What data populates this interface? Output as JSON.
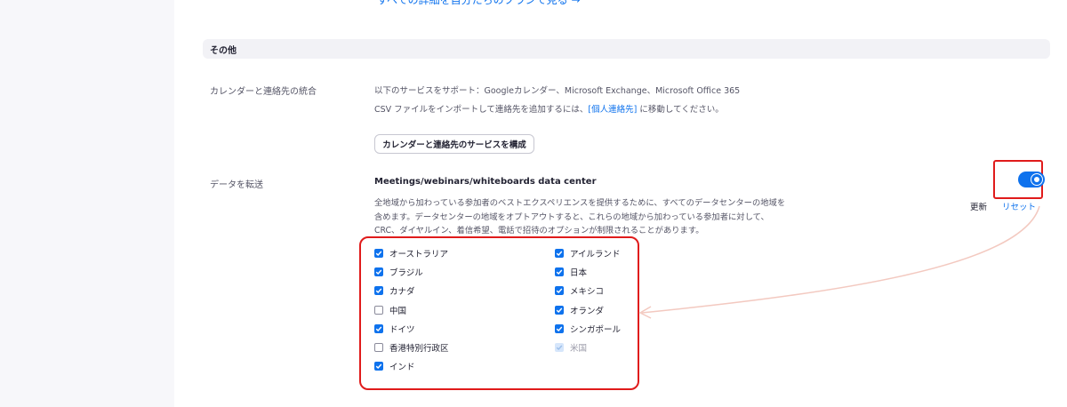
{
  "top_cut_text": "すべての詳細を自分たちのプランで見る →",
  "section": {
    "title": "その他"
  },
  "calendar_integration": {
    "label": "カレンダーと連絡先の統合",
    "line1": "以下のサービスをサポート：Googleカレンダー、Microsoft Exchange、Microsoft Office 365",
    "line2_prefix": "CSV ファイルをインポートして連絡先を追加するには、",
    "line2_link": "[個人連絡先]",
    "line2_suffix": " に移動してください。",
    "button_label": "カレンダーと連絡先のサービスを構成"
  },
  "data_transfer": {
    "label": "データを転送",
    "heading": "Meetings/webinars/whiteboards data center",
    "description": [
      "全地域から加わっている参加者のベストエクスペリエンスを提供するために、すべてのデータセンターの地域を",
      "含めます。データセンターの地域をオプトアウトすると、これらの地域から加わっている参加者に対して、",
      "CRC、ダイヤルイン、着信希望、電話で招待のオプションが制限されることがあります。"
    ],
    "toggle_on": true,
    "update_label": "更新",
    "reset_label": "リセット",
    "regions_left": [
      {
        "label": "オーストラリア",
        "state": "checked"
      },
      {
        "label": "ブラジル",
        "state": "checked"
      },
      {
        "label": "カナダ",
        "state": "checked"
      },
      {
        "label": "中国",
        "state": "unchecked"
      },
      {
        "label": "ドイツ",
        "state": "checked"
      },
      {
        "label": "香港特別行政区",
        "state": "unchecked"
      },
      {
        "label": "インド",
        "state": "checked"
      }
    ],
    "regions_right": [
      {
        "label": "アイルランド",
        "state": "checked"
      },
      {
        "label": "日本",
        "state": "checked"
      },
      {
        "label": "メキシコ",
        "state": "checked"
      },
      {
        "label": "オランダ",
        "state": "checked"
      },
      {
        "label": "シンガポール",
        "state": "checked"
      },
      {
        "label": "米国",
        "state": "disabled"
      }
    ]
  },
  "colors": {
    "accent": "#0e72ed",
    "highlight": "#e01b1b",
    "arrow": "#f3c9c0"
  }
}
